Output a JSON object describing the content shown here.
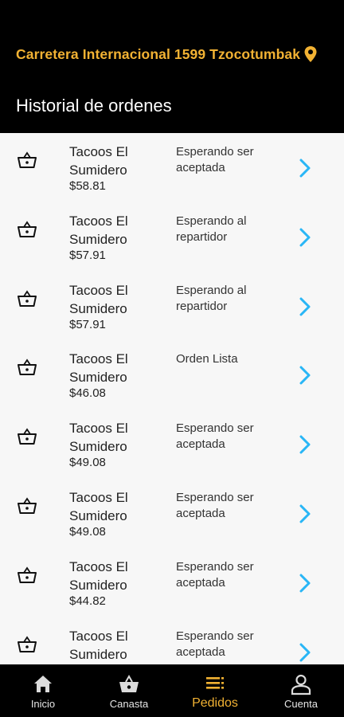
{
  "header": {
    "address": "Carretera Internacional 1599 Tzocotumbak",
    "title": "Historial de ordenes"
  },
  "orders": [
    {
      "store": "Tacoos El Sumidero",
      "price": "$58.81",
      "status": "Esperando ser aceptada"
    },
    {
      "store": "Tacoos El Sumidero",
      "price": "$57.91",
      "status": "Esperando al repartidor"
    },
    {
      "store": "Tacoos El Sumidero",
      "price": "$57.91",
      "status": "Esperando al repartidor"
    },
    {
      "store": "Tacoos El Sumidero",
      "price": "$46.08",
      "status": "Orden Lista"
    },
    {
      "store": "Tacoos El Sumidero",
      "price": "$49.08",
      "status": "Esperando ser aceptada"
    },
    {
      "store": "Tacoos El Sumidero",
      "price": "$49.08",
      "status": "Esperando ser aceptada"
    },
    {
      "store": "Tacoos El Sumidero",
      "price": "$44.82",
      "status": "Esperando ser aceptada"
    },
    {
      "store": "Tacoos El Sumidero",
      "price": "",
      "status": "Esperando ser aceptada"
    }
  ],
  "nav": {
    "items": [
      {
        "label": "Inicio",
        "icon": "home-icon"
      },
      {
        "label": "Canasta",
        "icon": "basket-icon"
      },
      {
        "label": "Pedidos",
        "icon": "list-icon",
        "active": true
      },
      {
        "label": "Cuenta",
        "icon": "user-icon"
      }
    ]
  },
  "colors": {
    "accent": "#f2b233",
    "chevron": "#29b6f6",
    "background": "#f7f7f7",
    "bar": "#000000"
  }
}
